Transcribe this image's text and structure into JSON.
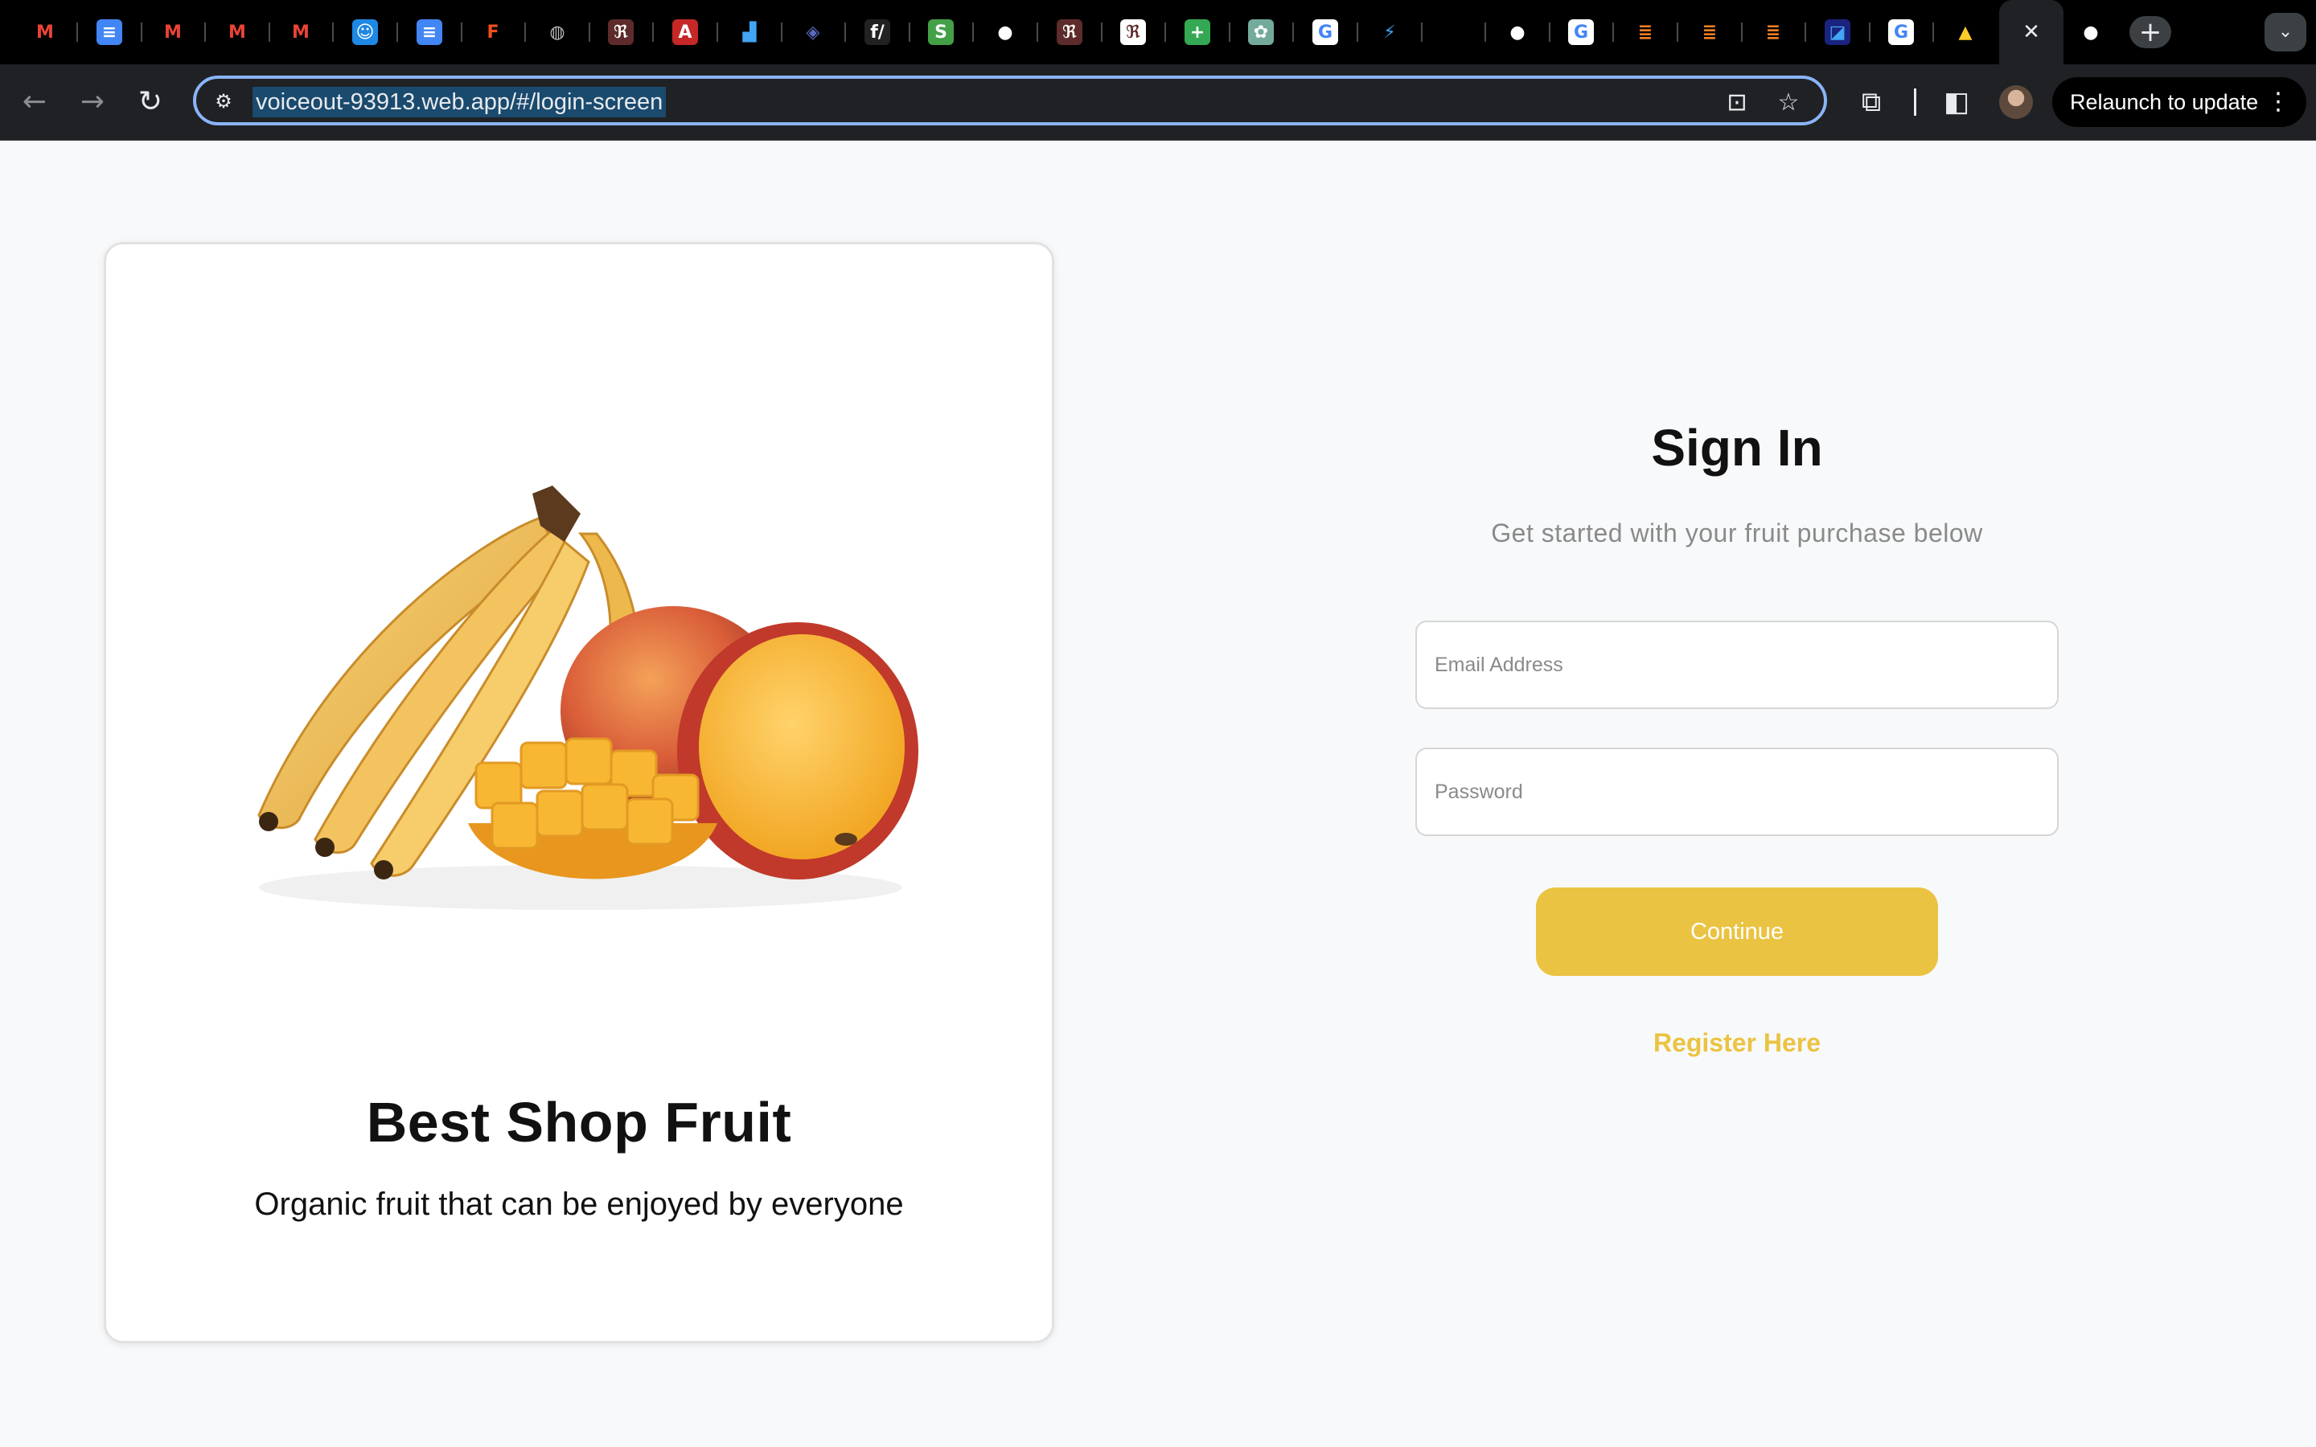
{
  "browser": {
    "favicons": [
      {
        "name": "gmail-icon",
        "glyph": "M",
        "bg": "#000000",
        "fg": "#ea4335"
      },
      {
        "name": "google-docs-icon",
        "glyph": "≡",
        "bg": "#4285f4",
        "fg": "#ffffff"
      },
      {
        "name": "gmail-icon",
        "glyph": "M",
        "bg": "#000000",
        "fg": "#ea4335"
      },
      {
        "name": "gmail-icon",
        "glyph": "M",
        "bg": "#000000",
        "fg": "#ea4335"
      },
      {
        "name": "gmail-icon",
        "glyph": "M",
        "bg": "#000000",
        "fg": "#ea4335"
      },
      {
        "name": "finder-icon",
        "glyph": "☺",
        "bg": "#1e88e5",
        "fg": "#ffffff"
      },
      {
        "name": "google-docs-icon",
        "glyph": "≡",
        "bg": "#4285f4",
        "fg": "#ffffff"
      },
      {
        "name": "figma-icon",
        "glyph": "F",
        "bg": "#000000",
        "fg": "#f24e1e"
      },
      {
        "name": "globe-icon",
        "glyph": "◍",
        "bg": "#000000",
        "fg": "#bdbdbd"
      },
      {
        "name": "app-icon",
        "glyph": "ℜ",
        "bg": "#5d2b2b",
        "fg": "#ffffff"
      },
      {
        "name": "pdf-icon",
        "glyph": "A",
        "bg": "#c62828",
        "fg": "#ffffff"
      },
      {
        "name": "analytics-icon",
        "glyph": "▟",
        "bg": "#000000",
        "fg": "#42a5f5"
      },
      {
        "name": "layers-icon",
        "glyph": "◈",
        "bg": "#000000",
        "fg": "#5c6bc0"
      },
      {
        "name": "code-icon",
        "glyph": "f/",
        "bg": "#222222",
        "fg": "#ffffff"
      },
      {
        "name": "location-icon",
        "glyph": "S",
        "bg": "#43a047",
        "fg": "#ffffff"
      },
      {
        "name": "github-icon",
        "glyph": "●",
        "bg": "#000000",
        "fg": "#ffffff"
      },
      {
        "name": "app-icon",
        "glyph": "ℜ",
        "bg": "#5d2b2b",
        "fg": "#ffffff"
      },
      {
        "name": "app-icon",
        "glyph": "ℜ",
        "bg": "#ffffff",
        "fg": "#5d2b2b"
      },
      {
        "name": "google-sheets-icon",
        "glyph": "+",
        "bg": "#34a853",
        "fg": "#ffffff"
      },
      {
        "name": "chatgpt-icon",
        "glyph": "✿",
        "bg": "#74aa9c",
        "fg": "#ffffff"
      },
      {
        "name": "google-icon",
        "glyph": "G",
        "bg": "#ffffff",
        "fg": "#4285f4"
      },
      {
        "name": "flutter-icon",
        "glyph": "⚡",
        "bg": "#000000",
        "fg": "#42a5f5"
      },
      {
        "name": "blank-tab-icon",
        "glyph": "",
        "bg": "#000000",
        "fg": "#000000"
      },
      {
        "name": "github-icon",
        "glyph": "●",
        "bg": "#000000",
        "fg": "#ffffff"
      },
      {
        "name": "google-icon",
        "glyph": "G",
        "bg": "#ffffff",
        "fg": "#4285f4"
      },
      {
        "name": "stackoverflow-icon",
        "glyph": "≣",
        "bg": "#000000",
        "fg": "#f48024"
      },
      {
        "name": "stackoverflow-icon",
        "glyph": "≣",
        "bg": "#000000",
        "fg": "#f48024"
      },
      {
        "name": "stackoverflow-icon",
        "glyph": "≣",
        "bg": "#000000",
        "fg": "#f48024"
      },
      {
        "name": "app-icon",
        "glyph": "◪",
        "bg": "#1a237e",
        "fg": "#42a5f5"
      },
      {
        "name": "google-icon",
        "glyph": "G",
        "bg": "#ffffff",
        "fg": "#4285f4"
      },
      {
        "name": "firebase-icon",
        "glyph": "▲",
        "bg": "#000000",
        "fg": "#ffca28"
      }
    ],
    "active_tab": {
      "close_glyph": "✕"
    },
    "after_active_tab": {
      "name": "github-icon",
      "glyph": "●",
      "bg": "#000000",
      "fg": "#ffffff"
    },
    "new_tab_glyph": "+",
    "tab_list_glyph": "⌄",
    "back_glyph": "←",
    "forward_glyph": "→",
    "reload_glyph": "↻",
    "site_info_glyph": "⚙",
    "url": "voiceout-93913.web.app/#/login-screen",
    "install_glyph": "⊡",
    "bookmark_glyph": "☆",
    "extensions_glyph": "⧉",
    "sidepanel_glyph": "◧",
    "relaunch_label": "Relaunch to update",
    "menu_glyph": "⋮"
  },
  "card": {
    "title": "Best Shop Fruit",
    "subtitle": "Organic fruit that can be enjoyed by everyone"
  },
  "signin": {
    "title": "Sign In",
    "subtitle": "Get started with your fruit purchase below",
    "email_placeholder": "Email Address",
    "password_placeholder": "Password",
    "continue_label": "Continue",
    "register_label": "Register Here"
  },
  "colors": {
    "accent": "#ebc342",
    "page_bg": "#f8f9fa"
  }
}
